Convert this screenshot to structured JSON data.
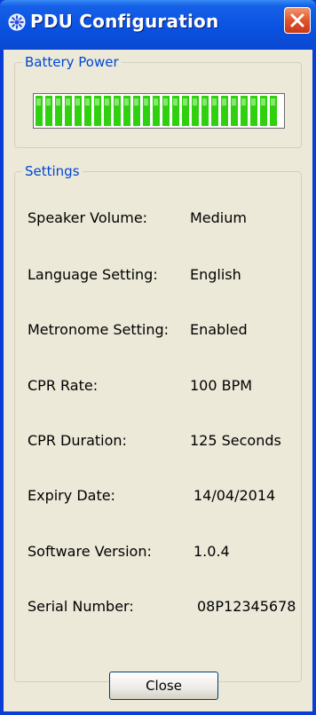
{
  "window": {
    "title": "PDU Configuration",
    "title_icon": "gear-icon",
    "close_icon": "close-icon"
  },
  "battery": {
    "legend": "Battery Power",
    "level_fraction": 1.0,
    "fill_color": "#2fd10f"
  },
  "settings": {
    "legend": "Settings",
    "items": [
      {
        "label": "Speaker Volume:",
        "value": "Medium"
      },
      {
        "label": "Language Setting:",
        "value": "English"
      },
      {
        "label": "Metronome Setting:",
        "value": "Enabled"
      },
      {
        "label": "CPR Rate:",
        "value": "100 BPM"
      },
      {
        "label": "CPR Duration:",
        "value": "125 Seconds"
      },
      {
        "label": "Expiry Date:",
        "value": "14/04/2014"
      },
      {
        "label": "Software Version:",
        "value": "1.0.4"
      },
      {
        "label": "Serial Number:",
        "value": "08P12345678"
      }
    ]
  },
  "buttons": {
    "close_label": "Close"
  },
  "colors": {
    "titlebar": "#0a52e0",
    "frame": "#0a3cd6",
    "dialog_bg": "#ece9d8",
    "legend_text": "#0046d5",
    "close_button": "#e0542a"
  }
}
